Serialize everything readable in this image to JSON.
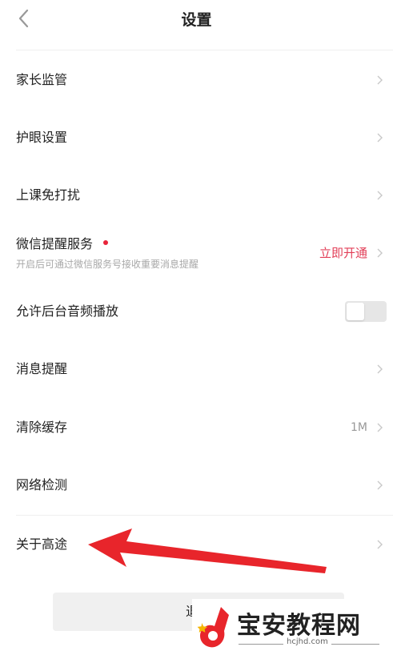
{
  "header": {
    "title": "设置"
  },
  "rows": [
    {
      "label": "家长监管"
    },
    {
      "label": "护眼设置"
    },
    {
      "label": "上课免打扰"
    },
    {
      "label": "微信提醒服务",
      "subtitle": "开启后可通过微信服务号接收重要消息提醒",
      "action": "立即开通"
    },
    {
      "label": "允许后台音频播放",
      "toggle_on": false
    },
    {
      "label": "消息提醒"
    },
    {
      "label": "清除缓存",
      "value": "1M"
    },
    {
      "label": "网络检测"
    },
    {
      "label": "关于高途"
    }
  ],
  "logout_label": "退出",
  "watermark": {
    "text": "宝安教程网",
    "url": "hcjhd.com"
  },
  "colors": {
    "accent": "#e23e57",
    "arrow": "#e8252b",
    "dot": "#e8243a"
  }
}
